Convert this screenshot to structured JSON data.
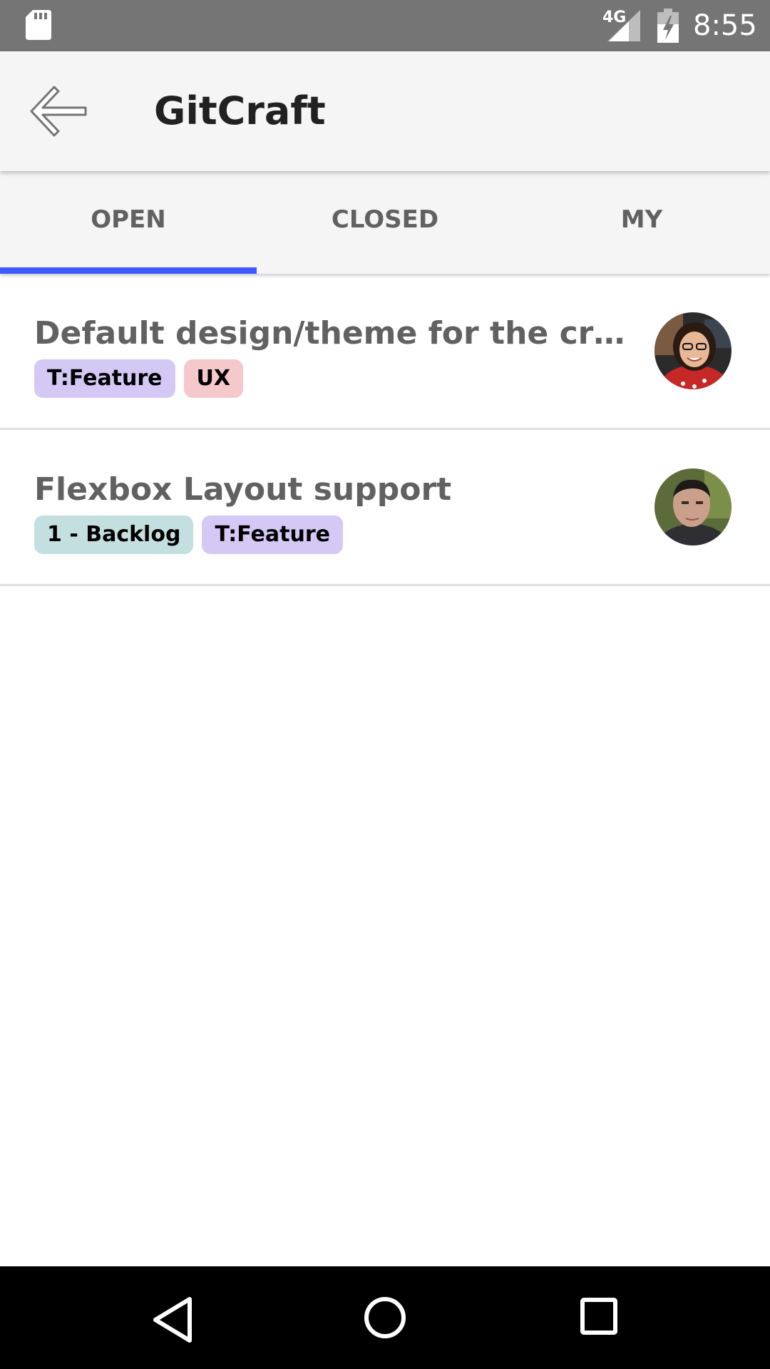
{
  "status_bar": {
    "network": "4G",
    "time": "8:55",
    "icons": [
      "sd-card-icon",
      "signal-icon",
      "battery-charging-icon"
    ]
  },
  "app_bar": {
    "title": "GitCraft",
    "back_icon": "arrow-left-icon"
  },
  "tabs": [
    {
      "label": "OPEN",
      "selected": true
    },
    {
      "label": "CLOSED",
      "selected": false
    },
    {
      "label": "MY",
      "selected": false
    }
  ],
  "colors": {
    "accent": "#3d5afe",
    "label_feature": "#d4c8f5",
    "label_ux": "#f5c9cb",
    "label_backlog": "#c3dfe0"
  },
  "issues": [
    {
      "title": "Default design/theme for the cross-p…",
      "labels": [
        {
          "text": "T:Feature",
          "color": "#d4c8f5"
        },
        {
          "text": "UX",
          "color": "#f5c9cb"
        }
      ],
      "avatar": "avatar-woman-with-glasses"
    },
    {
      "title": "Flexbox Layout support",
      "labels": [
        {
          "text": "1 - Backlog",
          "color": "#c3dfe0"
        },
        {
          "text": "T:Feature",
          "color": "#d4c8f5"
        }
      ],
      "avatar": "avatar-man"
    }
  ],
  "nav_bar": {
    "icons": [
      "nav-back-icon",
      "nav-home-icon",
      "nav-recents-icon"
    ]
  }
}
